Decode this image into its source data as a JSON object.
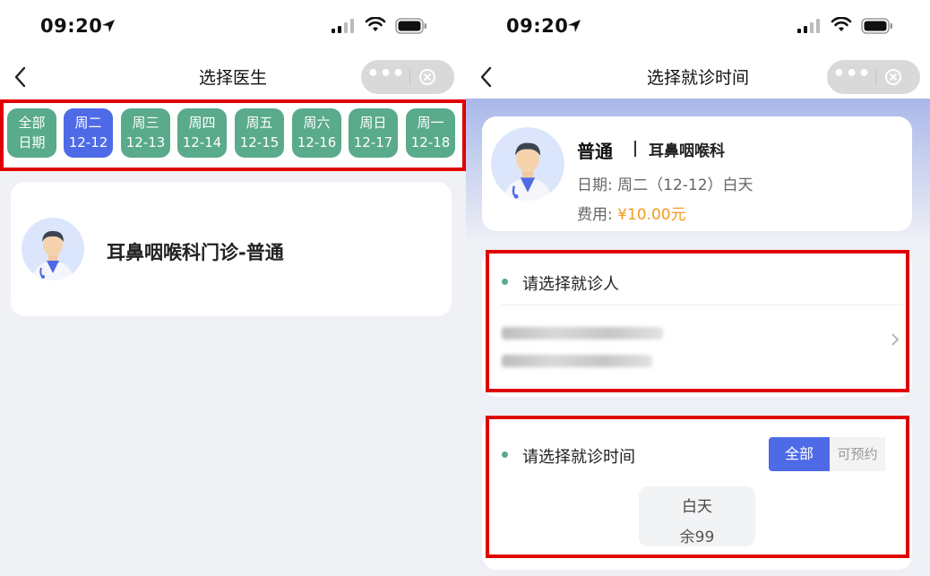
{
  "status_bar": {
    "time": "09:20"
  },
  "left": {
    "nav_title": "选择医生",
    "dates": [
      {
        "line1": "全部",
        "line2": "日期",
        "selected": false
      },
      {
        "line1": "周二",
        "line2": "12-12",
        "selected": true
      },
      {
        "line1": "周三",
        "line2": "12-13",
        "selected": false
      },
      {
        "line1": "周四",
        "line2": "12-14",
        "selected": false
      },
      {
        "line1": "周五",
        "line2": "12-15",
        "selected": false
      },
      {
        "line1": "周六",
        "line2": "12-16",
        "selected": false
      },
      {
        "line1": "周日",
        "line2": "12-17",
        "selected": false
      },
      {
        "line1": "周一",
        "line2": "12-18",
        "selected": false
      }
    ],
    "department_card": {
      "name": "耳鼻咽喉科门诊-普通"
    }
  },
  "right": {
    "nav_title": "选择就诊时间",
    "doctor": {
      "title": "普通",
      "department": "耳鼻咽喉科",
      "date_label": "日期:",
      "date_value": "周二（12-12）白天",
      "fee_label": "费用:",
      "fee_value": "¥10.00元"
    },
    "patient_section": {
      "title": "请选择就诊人"
    },
    "time_section": {
      "title": "请选择就诊时间",
      "tab_all": "全部",
      "tab_available": "可预约",
      "slot": {
        "period": "白天",
        "remaining": "余99"
      }
    }
  },
  "colors": {
    "green": "#5aaa8c",
    "blue": "#4e6ae6",
    "highlight_red": "#e00000",
    "fee_orange": "#f29b1f"
  }
}
